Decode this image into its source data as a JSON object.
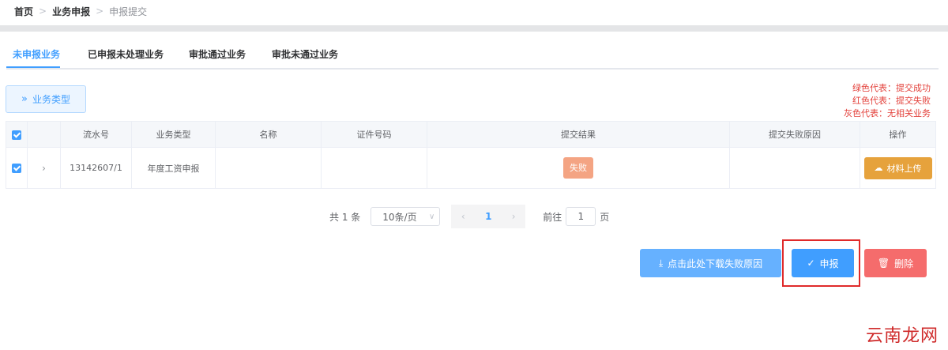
{
  "breadcrumb": {
    "home": "首页",
    "middle": "业务申报",
    "current": "申报提交",
    "separator": ">"
  },
  "tabs": [
    "未申报业务",
    "已申报未处理业务",
    "审批通过业务",
    "审批未通过业务"
  ],
  "type_button": {
    "icon": "double-chevron-right-icon",
    "label": "业务类型"
  },
  "legend": {
    "green": "绿色代表：提交成功",
    "red": "红色代表：提交失败",
    "gray": "灰色代表：无相关业务"
  },
  "table": {
    "headers": [
      "",
      "",
      "流水号",
      "业务类型",
      "名称",
      "证件号码",
      "提交结果",
      "提交失败原因",
      "操作"
    ],
    "rows": [
      {
        "serial": "13142607/1",
        "type": "年度工资申报",
        "name": "",
        "id_no": "",
        "result": "失败",
        "reason": "",
        "action": "材料上传"
      }
    ]
  },
  "pagination": {
    "total": "共 1 条",
    "page_size": "10条/页",
    "current_page": "1",
    "goto_label": "前往",
    "goto_value": "1",
    "page_unit": "页"
  },
  "actions": {
    "download": "点击此处下载失败原因",
    "submit": "申报",
    "delete": "删除"
  },
  "watermark": "云南龙网",
  "colors": {
    "primary": "#409eff",
    "warning": "#e6a23c",
    "danger": "#f56c6c",
    "fail": "#f4a483",
    "legend": "#e3413b"
  }
}
